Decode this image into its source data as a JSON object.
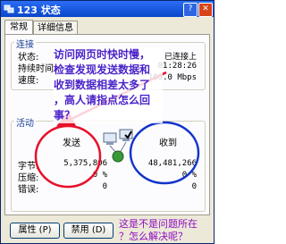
{
  "window": {
    "title": "123 状态",
    "tabs": [
      "常规",
      "详细信息"
    ]
  },
  "connection": {
    "group_label": "连接",
    "rows": [
      {
        "label": "状态:",
        "value": "已连接上"
      },
      {
        "label": "持续时间:",
        "value": "01:28:26"
      },
      {
        "label": "速度:",
        "value": "100.0 Mbps"
      }
    ]
  },
  "activity": {
    "group_label": "活动",
    "sent_label": "发送",
    "received_label": "收到",
    "bytes_label": "字节:",
    "bytes_sent": "5,375,806",
    "bytes_received": "48,481,266",
    "compression_label": "压缩:",
    "compression_sent": "0 %",
    "compression_received": "0 %",
    "errors_label": "错误:",
    "errors_sent": "0",
    "errors_received": "0"
  },
  "annotation": {
    "line1": "访问网页时快时慢，",
    "line2": "检查发现发送数据和",
    "line3": "收到数据相差太多了",
    "line4": "，高人请指点怎么回",
    "line5": "事？",
    "bottom1": "这是不是问题所在",
    "bottom2": "？怎么解决呢？",
    "colors": {
      "text": "#4b23c9",
      "circle_red": "#e8102a",
      "circle_blue": "#1234c9",
      "arrow_red": "#e8102a",
      "bottom": "#8e0bc2"
    }
  },
  "buttons": {
    "properties": "属性 (P)",
    "disable": "禁用 (D)"
  }
}
